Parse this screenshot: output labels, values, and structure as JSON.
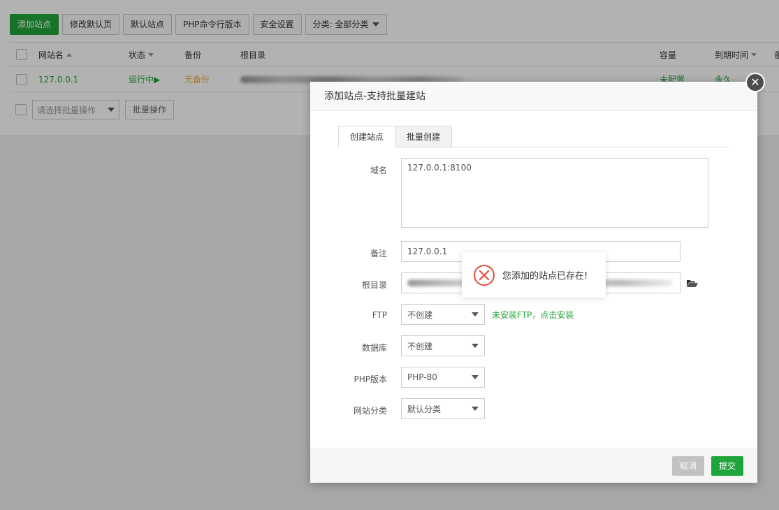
{
  "toolbar": {
    "add_site": "添加站点",
    "edit_default_page": "修改默认页",
    "default_site": "默认站点",
    "php_cli_version": "PHP命令行版本",
    "security_settings": "安全设置",
    "category_filter": "分类: 全部分类"
  },
  "table": {
    "headers": {
      "site_name": "网站名",
      "status": "状态",
      "backup": "备份",
      "root_dir": "根目录",
      "capacity": "容量",
      "expire": "到期时间",
      "remark_partial": "备"
    },
    "rows": [
      {
        "site_name": "127.0.0.1",
        "status": "运行中▶",
        "backup": "无备份",
        "capacity": "未配置",
        "expire": "永久"
      }
    ]
  },
  "batch": {
    "select_placeholder": "请选择批量操作",
    "button": "批量操作"
  },
  "modal": {
    "title": "添加站点-支持批量建站",
    "tabs": [
      "创建站点",
      "批量创建"
    ],
    "labels": {
      "domain": "域名",
      "remark": "备注",
      "root_dir": "根目录",
      "ftp": "FTP",
      "database": "数据库",
      "php_version": "PHP版本",
      "site_category": "网站分类"
    },
    "values": {
      "domain": "127.0.0.1:8100",
      "remark": "127.0.0.1",
      "ftp": "不创建",
      "database": "不创建",
      "php_version": "PHP-80",
      "site_category": "默认分类"
    },
    "ftp_hint": "未安装FTP，点击安装",
    "cancel": "取消",
    "submit": "提交"
  },
  "toast": {
    "message": "您添加的站点已存在!"
  },
  "colors": {
    "brand_green": "#20a53a",
    "orange": "#f0ad4e",
    "error_red": "#e74c3c"
  }
}
